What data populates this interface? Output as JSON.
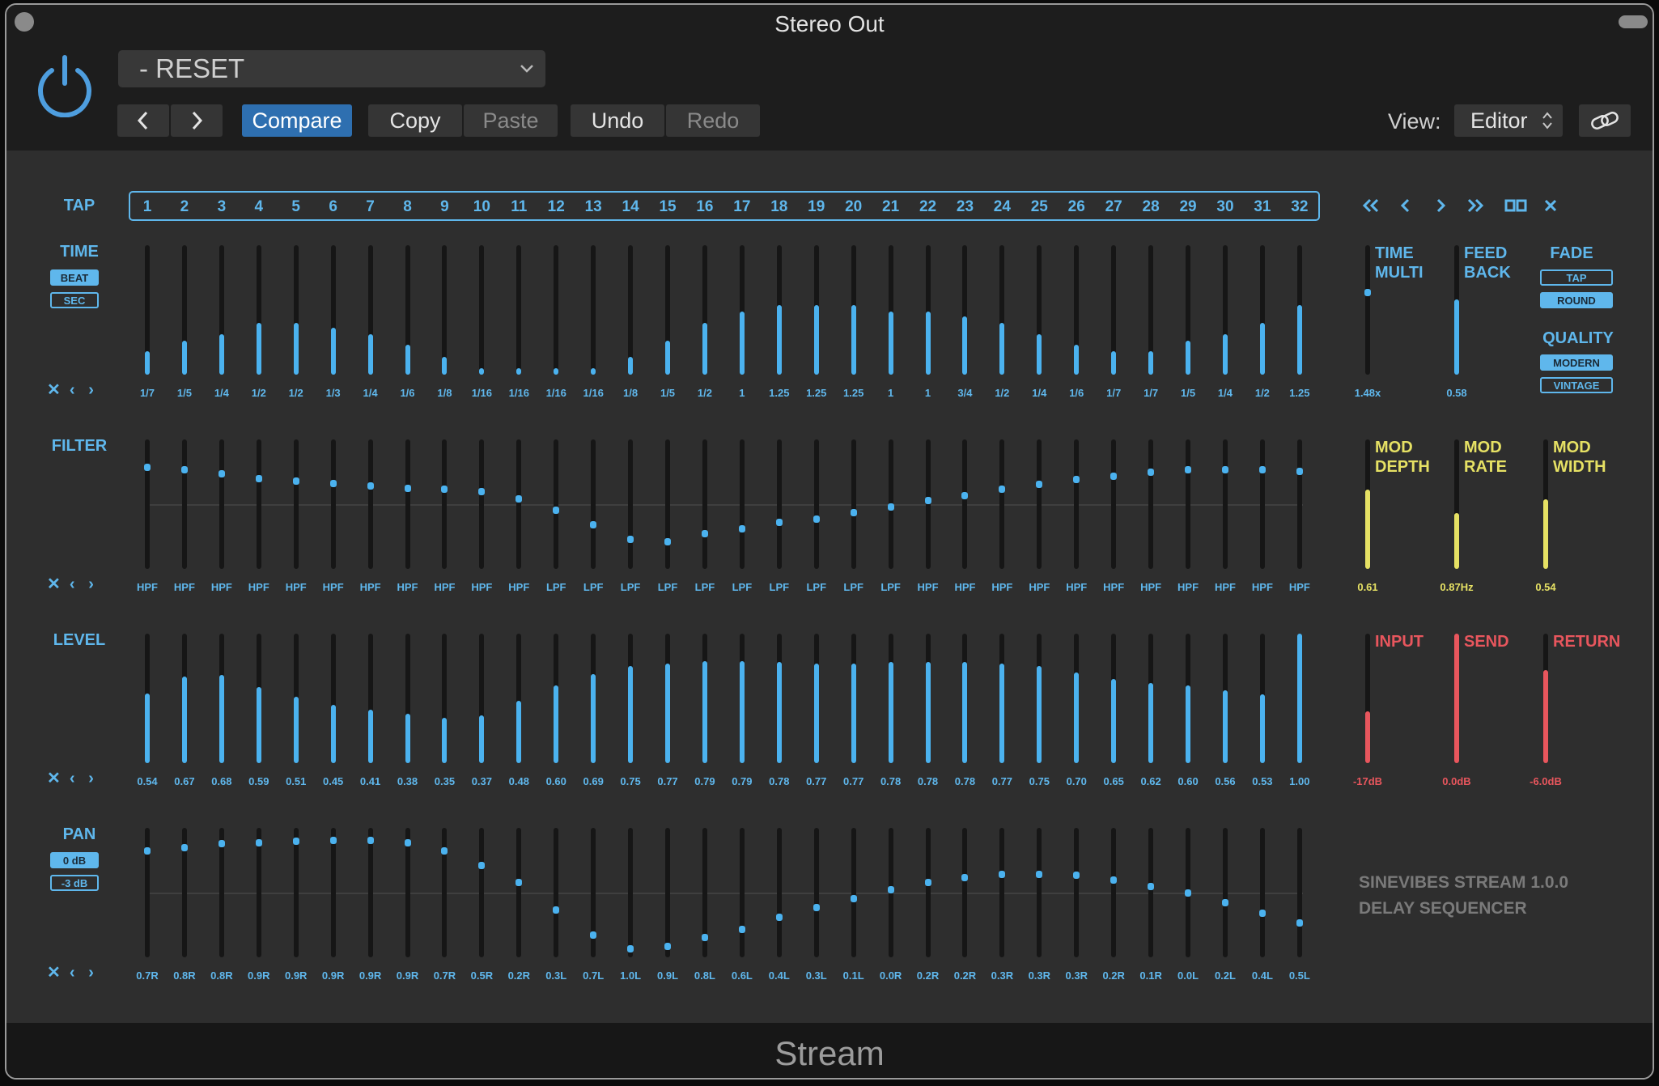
{
  "window": {
    "title": "Stereo Out",
    "plugin_name": "Stream"
  },
  "header": {
    "preset": "- RESET",
    "compare": "Compare",
    "copy": "Copy",
    "paste": "Paste",
    "undo": "Undo",
    "redo": "Redo",
    "view_label": "View:",
    "view_value": "Editor"
  },
  "accent": "#4bb2ef",
  "taps": {
    "label": "TAP",
    "numbers": [
      "1",
      "2",
      "3",
      "4",
      "5",
      "6",
      "7",
      "8",
      "9",
      "10",
      "11",
      "12",
      "13",
      "14",
      "15",
      "16",
      "17",
      "18",
      "19",
      "20",
      "21",
      "22",
      "23",
      "24",
      "25",
      "26",
      "27",
      "28",
      "29",
      "30",
      "31",
      "32"
    ]
  },
  "rows": {
    "time": {
      "label": "TIME",
      "beat": "BEAT",
      "sec": "SEC",
      "values": [
        "1/7",
        "1/5",
        "1/4",
        "1/2",
        "1/2",
        "1/3",
        "1/4",
        "1/6",
        "1/8",
        "1/16",
        "1/16",
        "1/16",
        "1/16",
        "1/8",
        "1/5",
        "1/2",
        "1",
        "1.25",
        "1.25",
        "1.25",
        "1",
        "1",
        "3/4",
        "1/2",
        "1/4",
        "1/6",
        "1/7",
        "1/7",
        "1/5",
        "1/4",
        "1/2",
        "1.25"
      ],
      "levels": [
        0.18,
        0.26,
        0.31,
        0.4,
        0.4,
        0.36,
        0.31,
        0.23,
        0.14,
        0.05,
        0.05,
        0.05,
        0.05,
        0.14,
        0.26,
        0.4,
        0.49,
        0.54,
        0.54,
        0.54,
        0.49,
        0.49,
        0.45,
        0.4,
        0.31,
        0.23,
        0.18,
        0.18,
        0.26,
        0.31,
        0.4,
        0.54
      ]
    },
    "filter": {
      "label": "FILTER",
      "values": [
        "HPF",
        "HPF",
        "HPF",
        "HPF",
        "HPF",
        "HPF",
        "HPF",
        "HPF",
        "HPF",
        "HPF",
        "HPF",
        "LPF",
        "LPF",
        "LPF",
        "LPF",
        "LPF",
        "LPF",
        "LPF",
        "LPF",
        "LPF",
        "LPF",
        "HPF",
        "HPF",
        "HPF",
        "HPF",
        "HPF",
        "HPF",
        "HPF",
        "HPF",
        "HPF",
        "HPF",
        "HPF"
      ],
      "positions": [
        0.2,
        0.22,
        0.25,
        0.29,
        0.31,
        0.33,
        0.35,
        0.37,
        0.38,
        0.4,
        0.46,
        0.55,
        0.67,
        0.79,
        0.81,
        0.74,
        0.7,
        0.65,
        0.62,
        0.57,
        0.52,
        0.47,
        0.43,
        0.38,
        0.34,
        0.3,
        0.27,
        0.24,
        0.22,
        0.22,
        0.22,
        0.23
      ]
    },
    "level": {
      "label": "LEVEL",
      "values": [
        "0.54",
        "0.67",
        "0.68",
        "0.59",
        "0.51",
        "0.45",
        "0.41",
        "0.38",
        "0.35",
        "0.37",
        "0.48",
        "0.60",
        "0.69",
        "0.75",
        "0.77",
        "0.79",
        "0.79",
        "0.78",
        "0.77",
        "0.77",
        "0.78",
        "0.78",
        "0.78",
        "0.77",
        "0.75",
        "0.70",
        "0.65",
        "0.62",
        "0.60",
        "0.56",
        "0.53",
        "1.00"
      ]
    },
    "pan": {
      "label": "PAN",
      "db0": "0 dB",
      "db3": "-3 dB",
      "values": [
        "0.7R",
        "0.8R",
        "0.8R",
        "0.9R",
        "0.9R",
        "0.9R",
        "0.9R",
        "0.9R",
        "0.7R",
        "0.5R",
        "0.2R",
        "0.3L",
        "0.7L",
        "1.0L",
        "0.9L",
        "0.8L",
        "0.6L",
        "0.4L",
        "0.3L",
        "0.1L",
        "0.0R",
        "0.2R",
        "0.2R",
        "0.3R",
        "0.3R",
        "0.3R",
        "0.2R",
        "0.1R",
        "0.0L",
        "0.2L",
        "0.4L",
        "0.5L"
      ],
      "positions": [
        0.16,
        0.13,
        0.1,
        0.09,
        0.08,
        0.07,
        0.07,
        0.09,
        0.16,
        0.28,
        0.42,
        0.64,
        0.85,
        0.96,
        0.94,
        0.87,
        0.8,
        0.7,
        0.62,
        0.55,
        0.48,
        0.42,
        0.38,
        0.35,
        0.35,
        0.36,
        0.4,
        0.45,
        0.5,
        0.58,
        0.67,
        0.75
      ]
    }
  },
  "side": {
    "time_multi": {
      "label1": "TIME",
      "label2": "MULTI",
      "value": "1.48x",
      "level": 0.64
    },
    "feedback": {
      "label1": "FEED",
      "label2": "BACK",
      "value": "0.58",
      "level": 0.58
    },
    "fade": {
      "label": "FADE",
      "tap": "TAP",
      "round": "ROUND"
    },
    "quality": {
      "label": "QUALITY",
      "modern": "MODERN",
      "vintage": "VINTAGE"
    },
    "mod_depth": {
      "label1": "MOD",
      "label2": "DEPTH",
      "value": "0.61",
      "level": 0.61
    },
    "mod_rate": {
      "label1": "MOD",
      "label2": "RATE",
      "value": "0.87Hz",
      "level": 0.43
    },
    "mod_width": {
      "label1": "MOD",
      "label2": "WIDTH",
      "value": "0.54",
      "level": 0.54
    },
    "input": {
      "label": "INPUT",
      "value": "-17dB",
      "level": 0.4
    },
    "send": {
      "label": "SEND",
      "value": "0.0dB",
      "level": 1.0
    },
    "return": {
      "label": "RETURN",
      "value": "-6.0dB",
      "level": 0.72
    }
  },
  "branding": {
    "line1": "SINEVIBES STREAM 1.0.0",
    "line2": "DELAY SEQUENCER"
  },
  "nav": {
    "clear": "✕",
    "prev": "‹",
    "next": "›"
  }
}
